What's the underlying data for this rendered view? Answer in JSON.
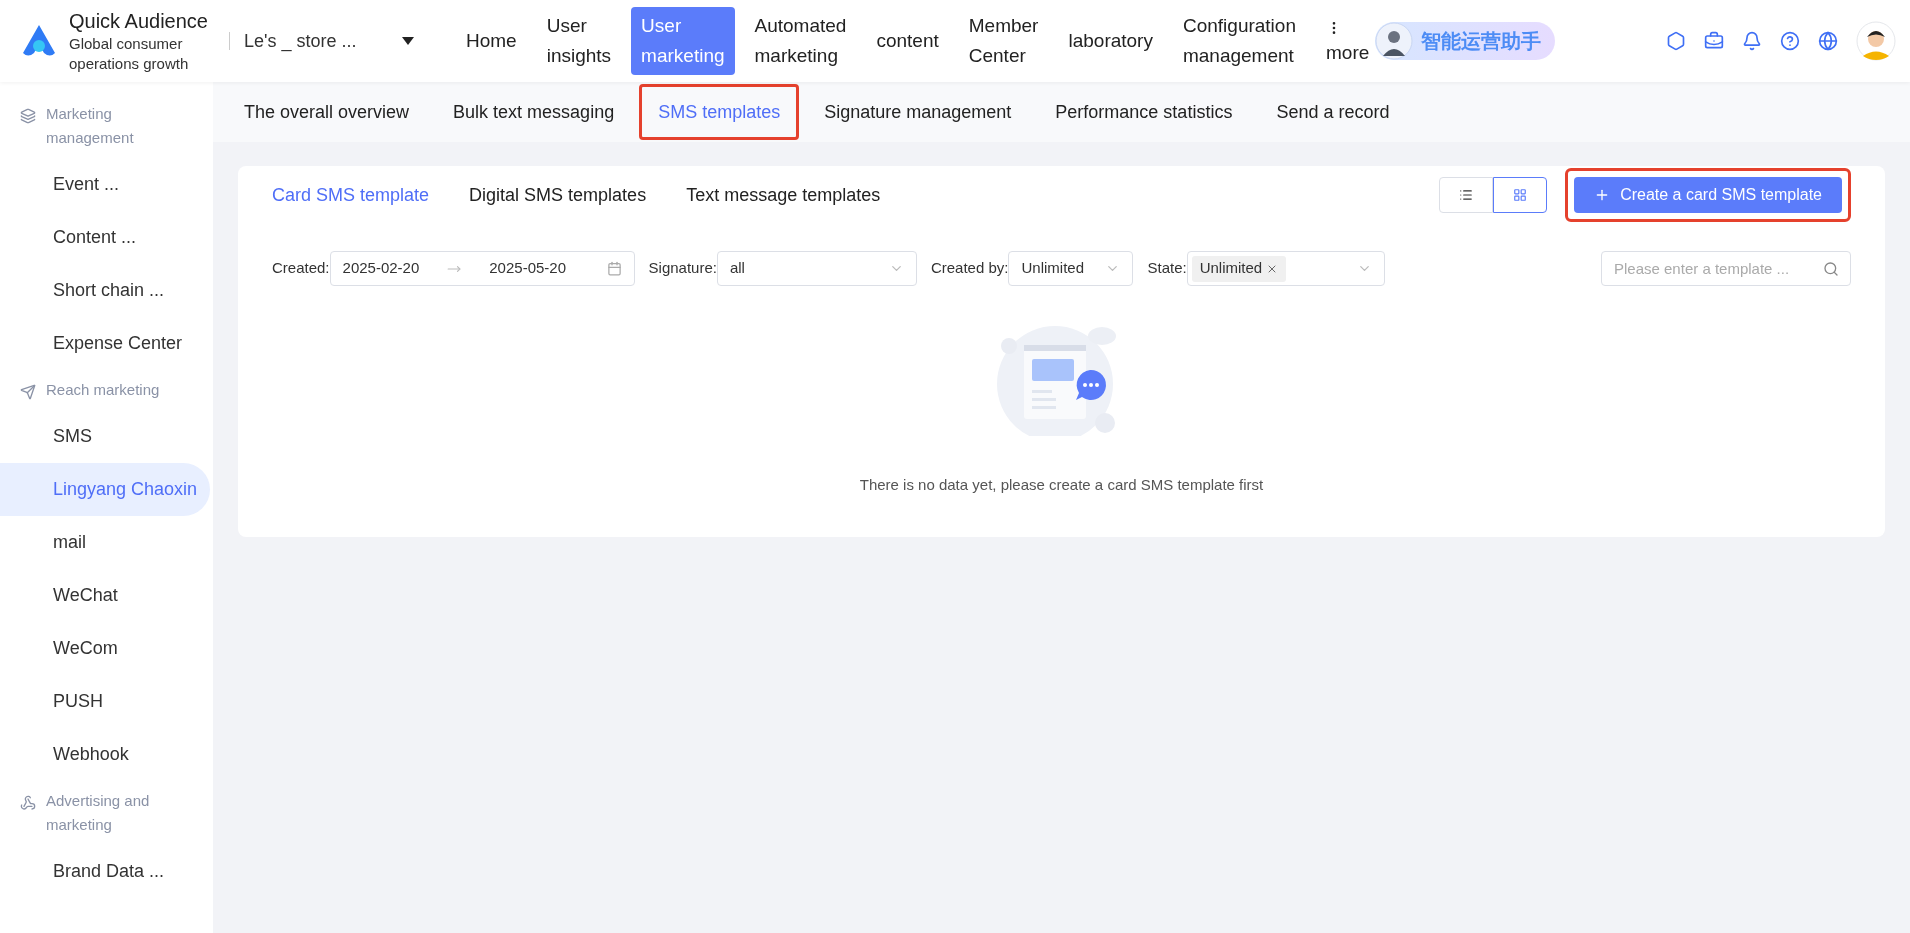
{
  "header": {
    "logo": {
      "title": "Quick Audience",
      "subtitle": "Global consumer operations growth"
    },
    "store_selector": {
      "value": "Le's _ store ..."
    },
    "nav": [
      {
        "label": "Home",
        "selected": false
      },
      {
        "label": "User insights",
        "selected": false
      },
      {
        "label": "User marketing",
        "selected": true
      },
      {
        "label": "Automated marketing",
        "selected": false
      },
      {
        "label": "content",
        "selected": false
      },
      {
        "label": "Member Center",
        "selected": false
      },
      {
        "label": "laboratory",
        "selected": false
      },
      {
        "label": "Configuration management",
        "selected": false
      },
      {
        "label": "more",
        "selected": false,
        "kind": "more"
      }
    ],
    "assistant": {
      "label": "智能运营助手"
    }
  },
  "sidebar": {
    "groups": [
      {
        "title": "Marketing management",
        "items": [
          {
            "label": "Event ...",
            "selected": false
          },
          {
            "label": "Content ...",
            "selected": false
          },
          {
            "label": "Short chain ...",
            "selected": false
          },
          {
            "label": "Expense Center",
            "selected": false
          }
        ]
      },
      {
        "title": "Reach marketing",
        "items": [
          {
            "label": "SMS",
            "selected": false
          },
          {
            "label": "Lingyang Chaoxin",
            "selected": true
          },
          {
            "label": "mail",
            "selected": false
          },
          {
            "label": "WeChat",
            "selected": false
          },
          {
            "label": "WeCom",
            "selected": false
          },
          {
            "label": "PUSH",
            "selected": false
          },
          {
            "label": "Webhook",
            "selected": false
          }
        ]
      },
      {
        "title": "Advertising and marketing",
        "items": [
          {
            "label": "Brand Data ...",
            "selected": false
          }
        ]
      }
    ]
  },
  "subtabs": [
    {
      "label": "The overall overview",
      "selected": false,
      "highlighted": false
    },
    {
      "label": "Bulk text messaging",
      "selected": false,
      "highlighted": false
    },
    {
      "label": "SMS templates",
      "selected": true,
      "highlighted": true
    },
    {
      "label": "Signature management",
      "selected": false,
      "highlighted": false
    },
    {
      "label": "Performance statistics",
      "selected": false,
      "highlighted": false
    },
    {
      "label": "Send a record",
      "selected": false,
      "highlighted": false
    }
  ],
  "card": {
    "tabs": [
      {
        "label": "Card SMS template",
        "selected": true
      },
      {
        "label": "Digital SMS templates",
        "selected": false
      },
      {
        "label": "Text message templates",
        "selected": false
      }
    ],
    "view_toggle": [
      {
        "kind": "list",
        "selected": false
      },
      {
        "kind": "grid",
        "selected": true
      }
    ],
    "create_button": {
      "label": "Create a card SMS template",
      "highlighted": true
    },
    "filters": {
      "created": {
        "label": "Created:",
        "start": "2025-02-20",
        "end": "2025-05-20"
      },
      "signature": {
        "label": "Signature:",
        "value": "all"
      },
      "created_by": {
        "label": "Created by:",
        "value": "Unlimited"
      },
      "state": {
        "label": "State:",
        "tags": [
          "Unlimited"
        ]
      },
      "search": {
        "placeholder": "Please enter a template ..."
      }
    },
    "empty_message": "There is no data yet, please create a card SMS template first"
  }
}
